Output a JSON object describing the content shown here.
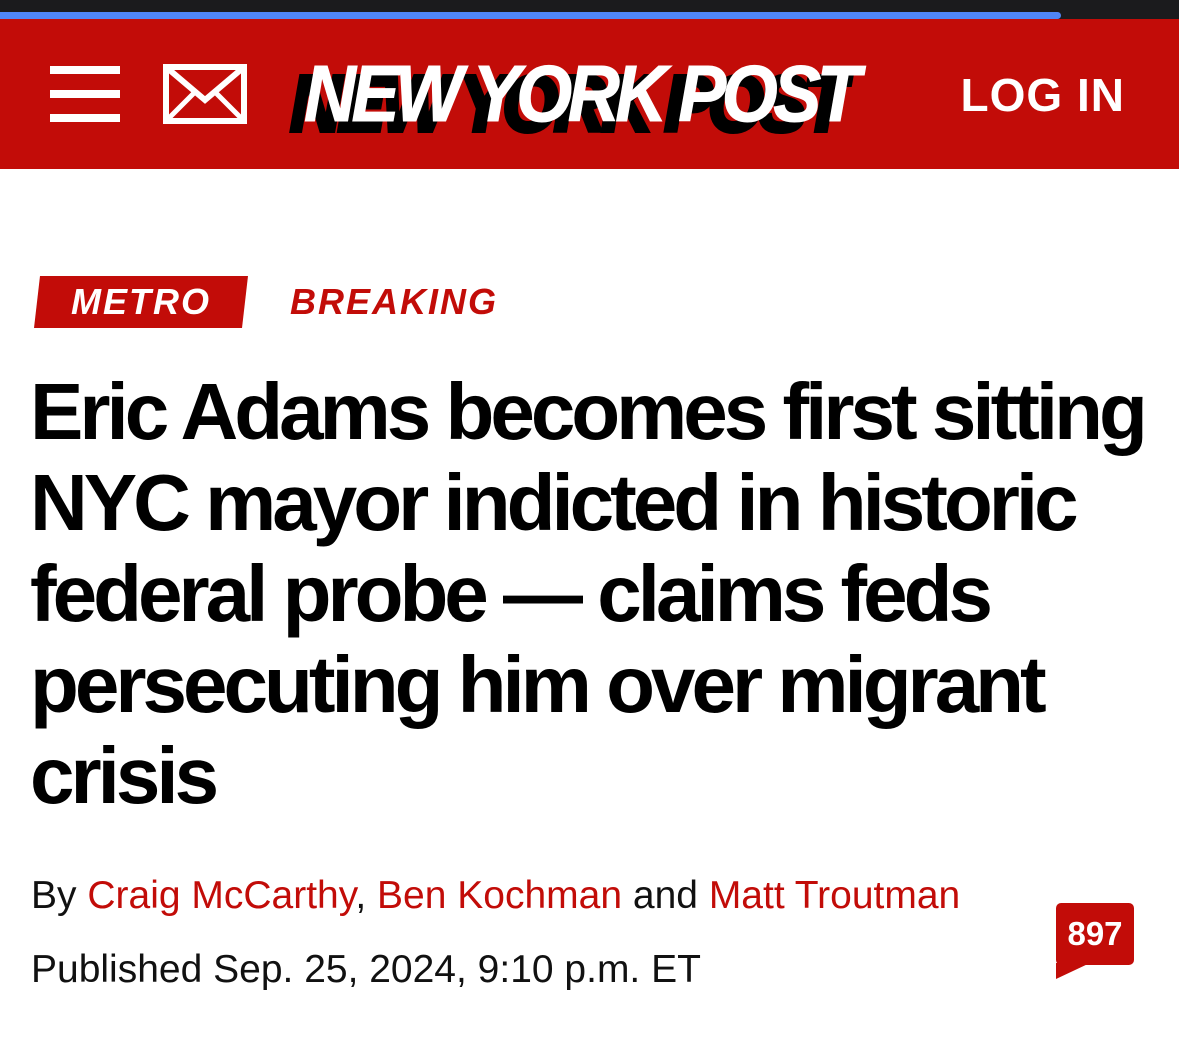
{
  "browser": {
    "load_progress": 0.9
  },
  "header": {
    "menu_icon": "hamburger-menu-icon",
    "mail_icon": "envelope-icon",
    "logo_text": "NEW YORK POST",
    "login_label": "LOG IN",
    "brand_color": "#c20c08"
  },
  "article": {
    "section_tag": "METRO",
    "status_tag": "BREAKING",
    "headline": "Eric Adams becomes first sitting NYC mayor indicted in historic federal probe — claims feds persecuting him over migrant crisis",
    "byline": {
      "prefix": "By",
      "authors": [
        "Craig McCarthy",
        "Ben Kochman",
        "Matt Troutman"
      ],
      "separator": ",",
      "conjunction": "and"
    },
    "published": "Published Sep. 25, 2024, 9:10 p.m. ET",
    "comment_count": "897"
  }
}
